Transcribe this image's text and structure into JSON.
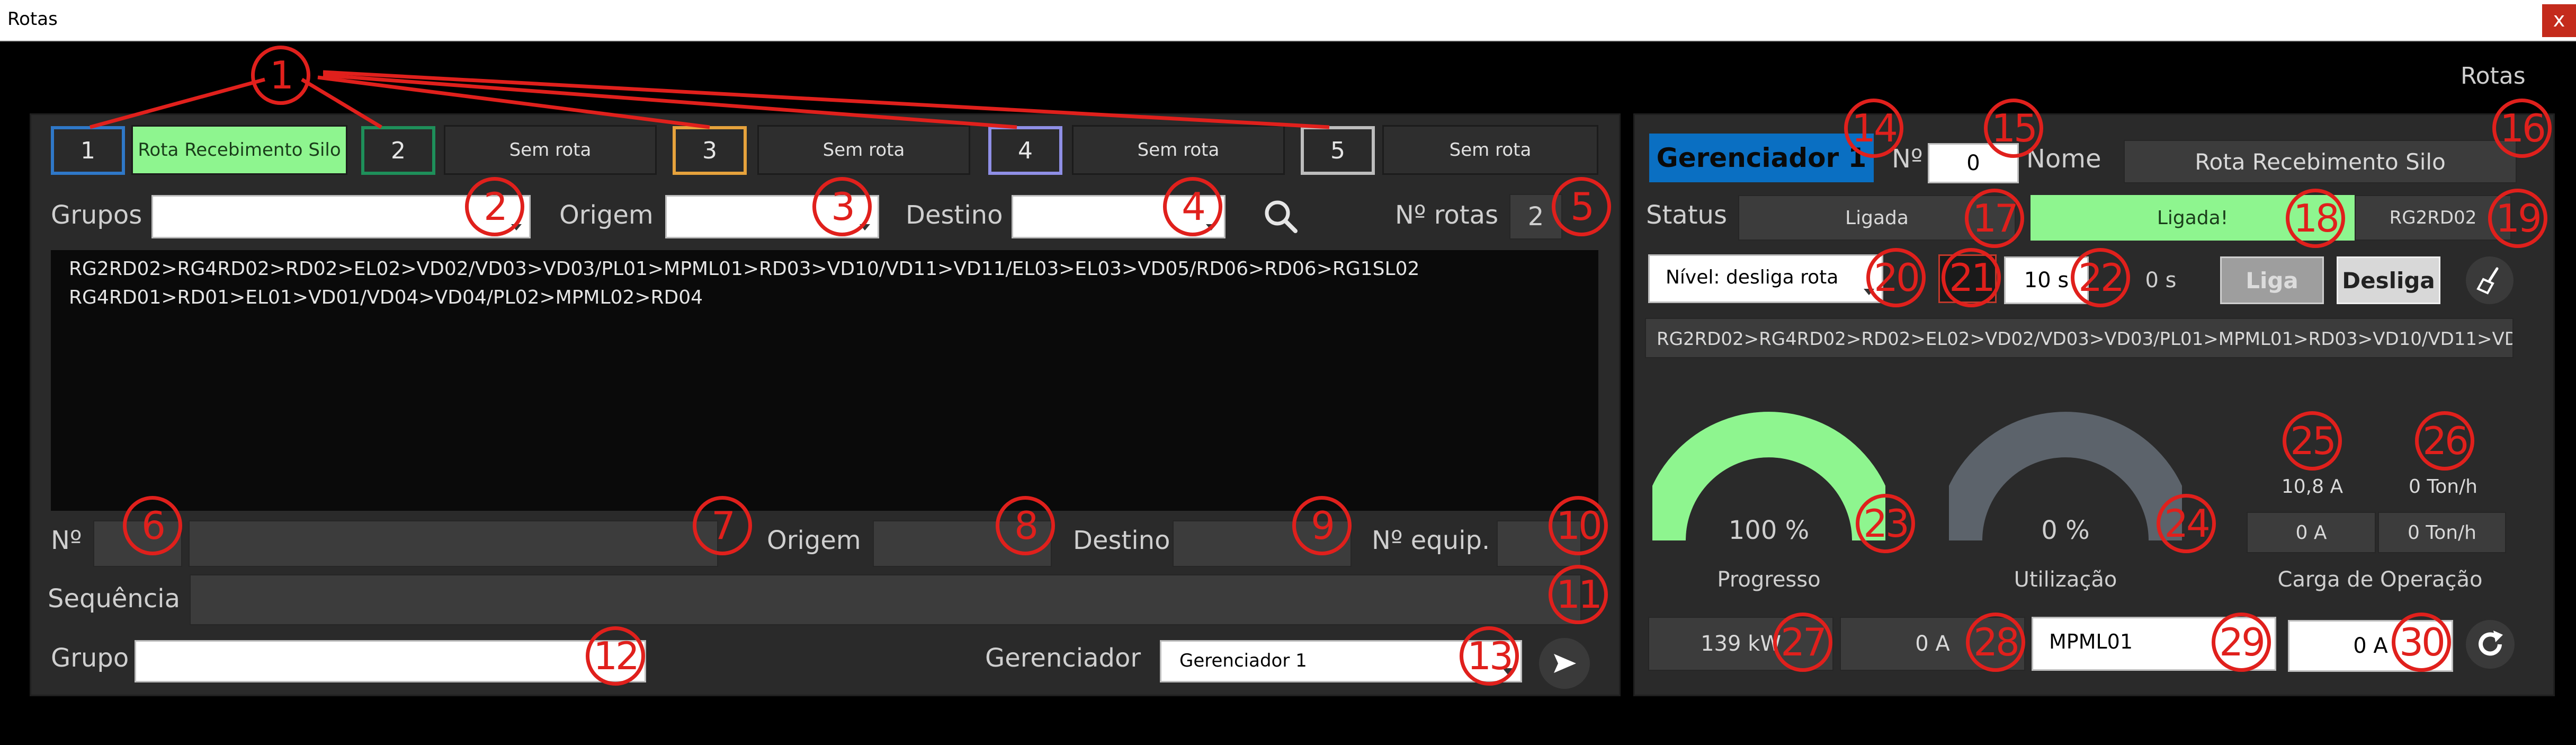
{
  "window": {
    "title": "Rotas",
    "close_label": "x",
    "section_title": "Rotas"
  },
  "tabs": [
    {
      "number": "1",
      "route": "Rota Recebimento Silo",
      "border_color": "#2f78c8",
      "active": true
    },
    {
      "number": "2",
      "route": "Sem rota",
      "border_color": "#1e8f5a",
      "active": false
    },
    {
      "number": "3",
      "route": "Sem rota",
      "border_color": "#e6a23c",
      "active": false
    },
    {
      "number": "4",
      "route": "Sem rota",
      "border_color": "#8f8fe6",
      "active": false
    },
    {
      "number": "5",
      "route": "Sem rota",
      "border_color": "#bdbdbd",
      "active": false
    }
  ],
  "filters": {
    "grupos_label": "Grupos",
    "origem_label": "Origem",
    "destino_label": "Destino",
    "n_rotas_label": "Nº rotas",
    "n_rotas_value": "2",
    "grupos_value": "",
    "origem_value": "",
    "destino_value": ""
  },
  "routes_list": [
    "RG2RD02>RG4RD02>RD02>EL02>VD02/VD03>VD03/PL01>MPML01>RD03>VD10/VD11>VD11/EL03>EL03>VD05/RD06>RD06>RG1SL02",
    "RG4RD01>RD01>EL01>VD01/VD04>VD04/PL02>MPML02>RD04"
  ],
  "detail": {
    "n_label": "Nº",
    "n_value": "",
    "name_value": "",
    "origem_label": "Origem",
    "origem_value": "",
    "destino_label": "Destino",
    "destino_value": "",
    "n_equip_label": "Nº equip.",
    "n_equip_value": "",
    "sequencia_label": "Sequência",
    "sequencia_value": "",
    "grupo_label": "Grupo",
    "grupo_value": "",
    "gerenciador_label": "Gerenciador",
    "gerenciador_value": "Gerenciador 1"
  },
  "manager": {
    "title": "Gerenciador 1",
    "n_label": "Nº",
    "n_value": "0",
    "nome_label": "Nome",
    "nome_value": "Rota Recebimento Silo",
    "status_label": "Status",
    "status_value": "Ligada",
    "status2_value": "Ligada!",
    "code_value": "RG2RD02",
    "nivel_value": "Nível: desliga rota",
    "timer_value": "10 s",
    "timer2_value": "0 s",
    "liga_label": "Liga",
    "desliga_label": "Desliga",
    "route_seq": "RG2RD02>RG4RD02>RD02>EL02>VD02/VD03>VD03/PL01>MPML01>RD03>VD10/VD11>VD11/EL03>",
    "progresso_label": "Progresso",
    "progresso_value": "100 %",
    "progresso_fraction": 1.0,
    "utilizacao_label": "Utilização",
    "utilizacao_value": "0 %",
    "utilizacao_fraction": 0.0,
    "carga_label": "Carga de Operação",
    "current_top": "10,8 A",
    "ton_top": "0 Ton/h",
    "current_box": "0 A",
    "ton_box": "0 Ton/h",
    "power_value": "139 kW",
    "current2_value": "0 A",
    "equip_input": "MPML01",
    "current3_value": "0 A"
  },
  "badges": [
    "1",
    "2",
    "3",
    "4",
    "5",
    "6",
    "7",
    "8",
    "9",
    "10",
    "11",
    "12",
    "13",
    "14",
    "15",
    "16",
    "17",
    "18",
    "19",
    "20",
    "21",
    "22",
    "23",
    "24",
    "25",
    "26",
    "27",
    "28",
    "29",
    "30"
  ],
  "colors": {
    "accent_blue": "#0a6fc2",
    "green": "#8ef58f",
    "badge_red": "#e0201c",
    "gauge_green": "#8ef58f",
    "gauge_gray": "#5c636b"
  }
}
